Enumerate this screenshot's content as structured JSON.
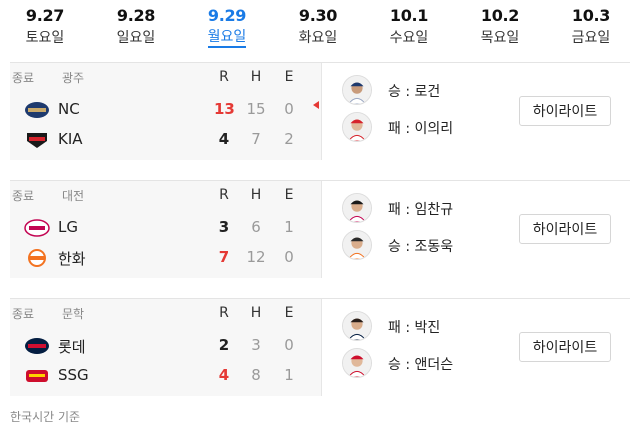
{
  "dates": [
    {
      "date": "9.27",
      "weekday": "토요일",
      "active": false
    },
    {
      "date": "9.28",
      "weekday": "일요일",
      "active": false
    },
    {
      "date": "9.29",
      "weekday": "월요일",
      "active": true
    },
    {
      "date": "9.30",
      "weekday": "화요일",
      "active": false
    },
    {
      "date": "10.1",
      "weekday": "수요일",
      "active": false
    },
    {
      "date": "10.2",
      "weekday": "목요일",
      "active": false
    },
    {
      "date": "10.3",
      "weekday": "금요일",
      "active": false
    }
  ],
  "headers": {
    "r": "R",
    "h": "H",
    "e": "E"
  },
  "games": [
    {
      "status": "종료",
      "venue": "광주",
      "teams": [
        {
          "name": "NC",
          "logo": "nc-dinos-logo",
          "r": "13",
          "h": "15",
          "e": "0",
          "winner": true
        },
        {
          "name": "KIA",
          "logo": "kia-tigers-logo",
          "r": "4",
          "h": "7",
          "e": "2",
          "winner": false
        }
      ],
      "pitchers": [
        {
          "label": "승 : 로건",
          "avatar": "pitcher-photo"
        },
        {
          "label": "패 : 이의리",
          "avatar": "pitcher-photo"
        }
      ],
      "highlight_label": "하이라이트"
    },
    {
      "status": "종료",
      "venue": "대전",
      "teams": [
        {
          "name": "LG",
          "logo": "lg-twins-logo",
          "r": "3",
          "h": "6",
          "e": "1",
          "winner": false
        },
        {
          "name": "한화",
          "logo": "hanwha-eagles-logo",
          "r": "7",
          "h": "12",
          "e": "0",
          "winner": true
        }
      ],
      "pitchers": [
        {
          "label": "패 : 임찬규",
          "avatar": "pitcher-photo"
        },
        {
          "label": "승 : 조동욱",
          "avatar": "pitcher-photo"
        }
      ],
      "highlight_label": "하이라이트"
    },
    {
      "status": "종료",
      "venue": "문학",
      "teams": [
        {
          "name": "롯데",
          "logo": "lotte-giants-logo",
          "r": "2",
          "h": "3",
          "e": "0",
          "winner": false
        },
        {
          "name": "SSG",
          "logo": "ssg-landers-logo",
          "r": "4",
          "h": "8",
          "e": "1",
          "winner": true
        }
      ],
      "pitchers": [
        {
          "label": "패 : 박진",
          "avatar": "pitcher-photo"
        },
        {
          "label": "승 : 앤더슨",
          "avatar": "pitcher-photo"
        }
      ],
      "highlight_label": "하이라이트"
    }
  ],
  "footnote": "한국시간 기준",
  "colors": {
    "accent": "#1a7be6",
    "win": "#e53935"
  }
}
